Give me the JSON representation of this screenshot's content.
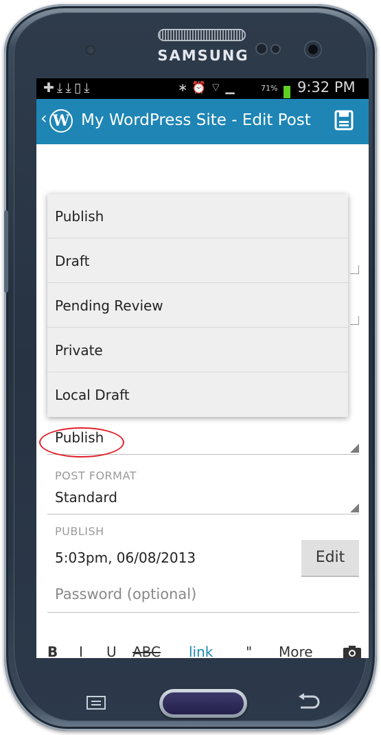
{
  "device": {
    "brand": "SAMSUNG"
  },
  "status_bar": {
    "battery": "71%",
    "time": "9:32 PM",
    "battery_color": "#5ecf23"
  },
  "app_bar": {
    "title": "My WordPress Site - Edit Post",
    "logo_letter": "W",
    "accent": "#1e85b5"
  },
  "partial_text": "...",
  "dropdown": {
    "options": [
      "Publish",
      "Draft",
      "Pending Review",
      "Private",
      "Local Draft"
    ]
  },
  "status": {
    "value": "Publish",
    "highlight_color": "#e0202a"
  },
  "post_format": {
    "label": "POST FORMAT",
    "value": "Standard"
  },
  "publish": {
    "label": "PUBLISH",
    "date": "5:03pm, 06/08/2013",
    "edit_button": "Edit"
  },
  "password": {
    "placeholder": "Password (optional)"
  },
  "toolbar": {
    "bold": "B",
    "italic": "I",
    "underline": "U",
    "strike": "ABC",
    "link": "link",
    "quote": "\"",
    "more": "More",
    "camera_icon": "camera-icon"
  },
  "nav_keys": {
    "menu_icon": "menu-icon",
    "home_icon": "home-button",
    "back_icon": "back-icon"
  }
}
